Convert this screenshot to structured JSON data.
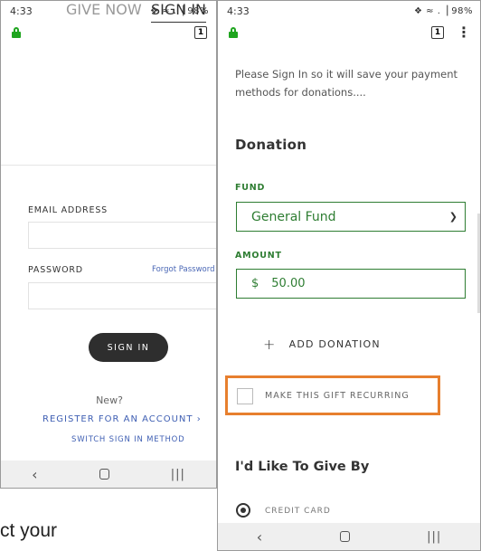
{
  "left_phone": {
    "status": {
      "time": "4:33",
      "icons": "❖ ≈ .▕ 98%"
    },
    "tab_count": "1",
    "tabs": {
      "give_now": "GIVE NOW",
      "sign_in": "SIGN IN"
    },
    "email_label": "EMAIL ADDRESS",
    "password_label": "PASSWORD",
    "forgot": "Forgot Password",
    "sign_in_button": "SIGN IN",
    "new_text": "New?",
    "register": "REGISTER FOR AN ACCOUNT  ›",
    "switch": "SWITCH SIGN IN METHOD",
    "nav": {
      "back": "‹",
      "recents": "|||"
    }
  },
  "right_phone": {
    "status": {
      "time": "4:33",
      "icons": "❖ ≈ .▕ 98%"
    },
    "tab_count": "1",
    "menu": "⋮",
    "intro": "Please Sign In so it will save your payment methods for donations....",
    "donation_heading": "Donation",
    "fund_label": "FUND",
    "fund_value": "General Fund",
    "amount_label": "AMOUNT",
    "currency": "$",
    "amount_value": "50.00",
    "add_donation": "ADD DONATION",
    "recurring_label": "MAKE THIS GIFT RECURRING",
    "give_by_heading": "I'd Like To Give By",
    "credit_card": "CREDIT CARD",
    "nav": {
      "back": "‹",
      "recents": "|||"
    }
  },
  "caption": "ct your",
  "colors": {
    "accent_green": "#2e7d32",
    "highlight": "#e77f2e",
    "link_blue": "#3f5fb3"
  }
}
